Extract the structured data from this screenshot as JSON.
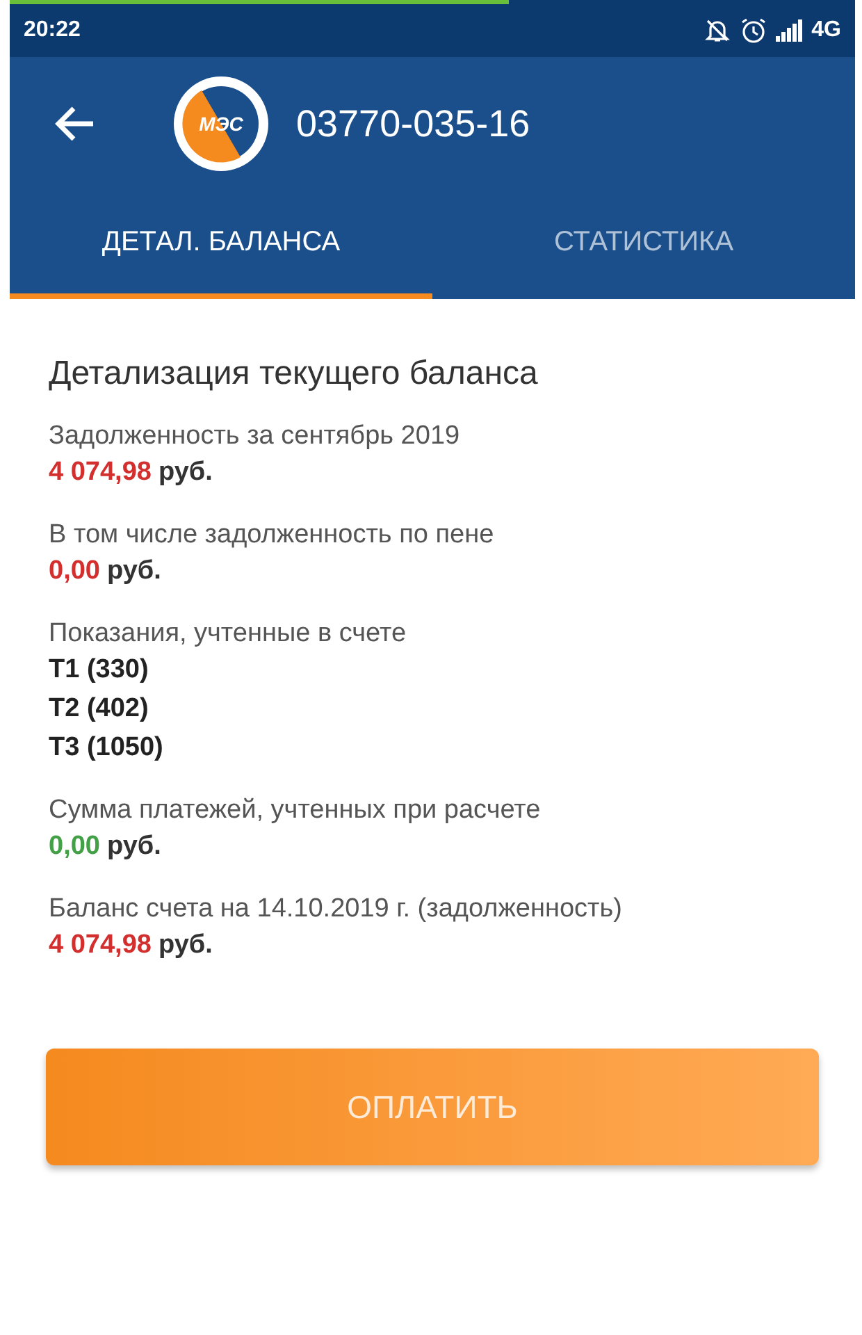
{
  "load_bar": {
    "level": 0.59
  },
  "status_bar": {
    "time": "20:22",
    "network": "4G"
  },
  "app_bar": {
    "logo_text": "МЭС",
    "title": "03770-035-16"
  },
  "tabs": [
    {
      "label": "ДЕТАЛ. БАЛАНСА",
      "selected": true
    },
    {
      "label": "СТАТИСТИКА",
      "selected": false
    }
  ],
  "heading": "Детализация текущего баланса",
  "items": [
    {
      "kind": "amount",
      "label": "Задолженность за сентябрь 2019",
      "amount": "4 074,98",
      "unit": "руб.",
      "color": "#d32f2f"
    },
    {
      "kind": "amount",
      "label": "В том числе задолженность по пене",
      "amount": "0,00",
      "unit": "руб.",
      "color": "#d32f2f"
    },
    {
      "kind": "readings",
      "label": "Показания, учтенные в счете",
      "lines": [
        "Т1 (330)",
        "Т2 (402)",
        "Т3 (1050)"
      ]
    },
    {
      "kind": "amount",
      "label": "Сумма платежей, учтенных при расчете",
      "amount": "0,00",
      "unit": "руб.",
      "color": "#43a047"
    },
    {
      "kind": "amount",
      "label": "Баланс счета на 14.10.2019 г. (задолженность)",
      "amount": "4 074,98",
      "unit": "руб.",
      "color": "#d32f2f"
    }
  ],
  "pay_button": "ОПЛАТИТЬ"
}
